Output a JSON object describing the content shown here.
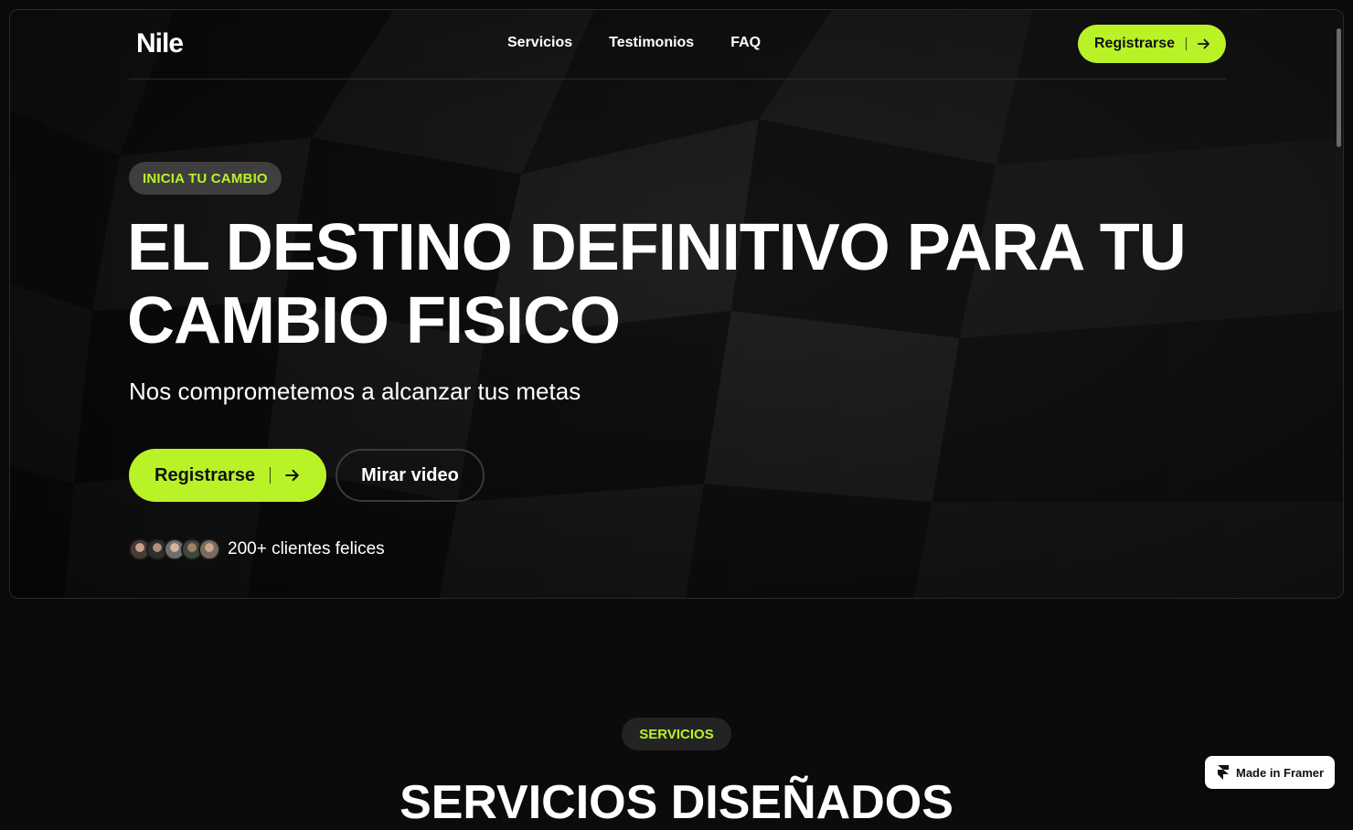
{
  "nav": {
    "logo": "Nile",
    "links": [
      "Servicios",
      "Testimonios",
      "FAQ"
    ],
    "cta_label": "Registrarse",
    "cta_icon": "arrow-right-icon"
  },
  "hero": {
    "badge": "INICIA TU CAMBIO",
    "headline_line1": "EL DESTINO DEFINITIVO PARA TU",
    "headline_line2": "CAMBIO FISICO",
    "subtitle": "Nos comprometemos a alcanzar tus metas",
    "primary_cta": "Registrarse",
    "secondary_cta": "Mirar video",
    "clients_text": "200+ clientes felices",
    "avatar_count": 5
  },
  "services": {
    "badge": "SERVICIOS",
    "title": "SERVICIOS DISEÑADOS"
  },
  "framer_badge": {
    "label": "Made in Framer",
    "icon": "framer-icon"
  },
  "colors": {
    "accent": "#b8f227",
    "background": "#0b0b0b",
    "text": "#ffffff"
  }
}
